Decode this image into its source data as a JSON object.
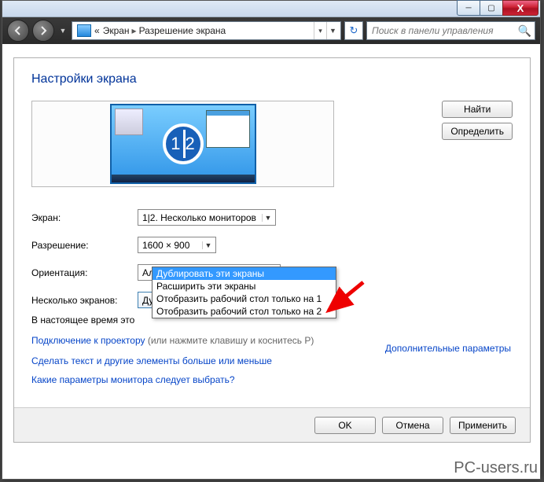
{
  "window": {
    "min_tooltip": "Свернуть",
    "max_tooltip": "Развернуть",
    "close_tooltip": "Закрыть"
  },
  "breadcrumb": {
    "chevrons": "«",
    "item1": "Экран",
    "item2": "Разрешение экрана"
  },
  "search": {
    "placeholder": "Поиск в панели управления"
  },
  "page": {
    "title": "Настройки экрана",
    "monitor_label_1": "1",
    "monitor_label_2": "2"
  },
  "buttons": {
    "find": "Найти",
    "identify": "Определить",
    "ok": "OK",
    "cancel": "Отмена",
    "apply": "Применить"
  },
  "form": {
    "screen_label": "Экран:",
    "screen_value": "1|2. Несколько мониторов",
    "resolution_label": "Разрешение:",
    "resolution_value": "1600 × 900",
    "orientation_label": "Ориентация:",
    "orientation_value": "Альбомная",
    "multi_label": "Несколько экранов:",
    "multi_value": "Дублировать эти экраны"
  },
  "dropdown_options": [
    "Дублировать эти экраны",
    "Расширить эти экраны",
    "Отобразить рабочий стол только на 1",
    "Отобразить рабочий стол только на 2"
  ],
  "text": {
    "current_msg_prefix": "В настоящее время это",
    "projector_link": "Подключение к проектору",
    "projector_suffix": "(или нажмите клавишу     и коснитесь P)",
    "advanced_link": "Дополнительные параметры",
    "resize_link": "Сделать текст и другие элементы больше или меньше",
    "monitor_params_link": "Какие параметры монитора следует выбрать?"
  },
  "watermark": "PC-users.ru"
}
